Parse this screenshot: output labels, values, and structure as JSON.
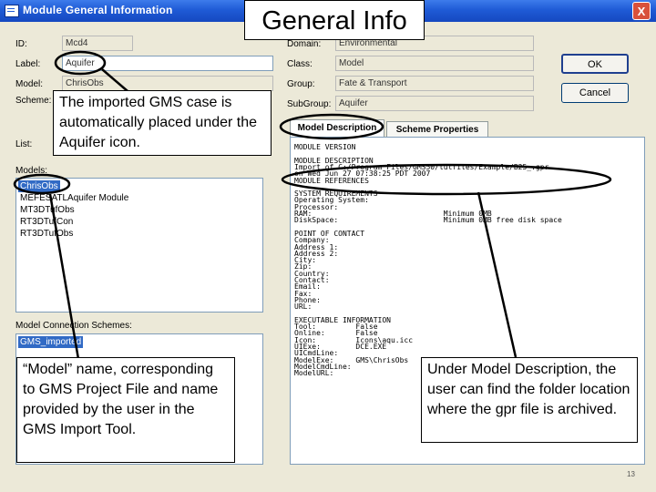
{
  "window": {
    "title": "Module General Information",
    "close": "X"
  },
  "slide_title": "General Info",
  "fields": {
    "id_label": "ID:",
    "id_value": "Mcd4",
    "label_label": "Label:",
    "label_value": "Aquifer",
    "model_label": "Model:",
    "model_value": "ChrisObs",
    "scheme_label": "Scheme:",
    "list_label": "List:",
    "domain_label": "Domain:",
    "domain_value": "Environmental",
    "class_label": "Class:",
    "class_value": "Model",
    "group_label": "Group:",
    "group_value": "Fate & Transport",
    "subgroup_label": "SubGroup:",
    "subgroup_value": "Aquifer"
  },
  "buttons": {
    "ok": "OK",
    "cancel": "Cancel"
  },
  "models": {
    "label": "Models:",
    "items": [
      "ChrisObs",
      "MEFESATLAquifer Module",
      "MT3DTufObs",
      "RT3DTufCon",
      "RT3DTufObs"
    ],
    "selected": 0
  },
  "connection_schemes": {
    "label": "Model Connection Schemes:",
    "items": [
      "GMS_imported"
    ]
  },
  "tabs": [
    "Model Description",
    "Scheme Properties"
  ],
  "description_lines": [
    "MODULE VERSION",
    "",
    "MODULE DESCRIPTION",
    "Import of C:/Program Files/GMS50/tutfiles/Example/B25_.gpr",
    "on Wed Jun 27 07:38:25 PDT 2007",
    "MODULE REFERENCES",
    "",
    "SYSTEM REQUIREMENTS",
    "Operating System:",
    "Processor:",
    "RAM:                              Minimum 0MB",
    "DiskSpace:                        Minimum 0MB free disk space",
    "",
    "POINT OF CONTACT",
    "Company:",
    "Address 1:",
    "Address 2:",
    "City:",
    "Zip:",
    "Country:",
    "Contact:",
    "Email:",
    "Fax:",
    "Phone:",
    "URL:",
    "",
    "EXECUTABLE INFORMATION",
    "Tool:         False",
    "Online:       False",
    "Icon:         Icons\\aqu.icc",
    "UIExe:        DCE.EXE",
    "UICmdLine:",
    "ModelExe:     GMS\\ChrisObs",
    "ModelCmdLine:",
    "ModelURL:"
  ],
  "callouts": {
    "aquifer": "The imported GMS case is automatically placed under the Aquifer icon.",
    "model_name": "“Model” name, corresponding to GMS Project File and name provided by the user in the GMS Import Tool.",
    "description": "Under Model Description, the user can find the folder location where the gpr file is archived."
  },
  "page_number": "13"
}
